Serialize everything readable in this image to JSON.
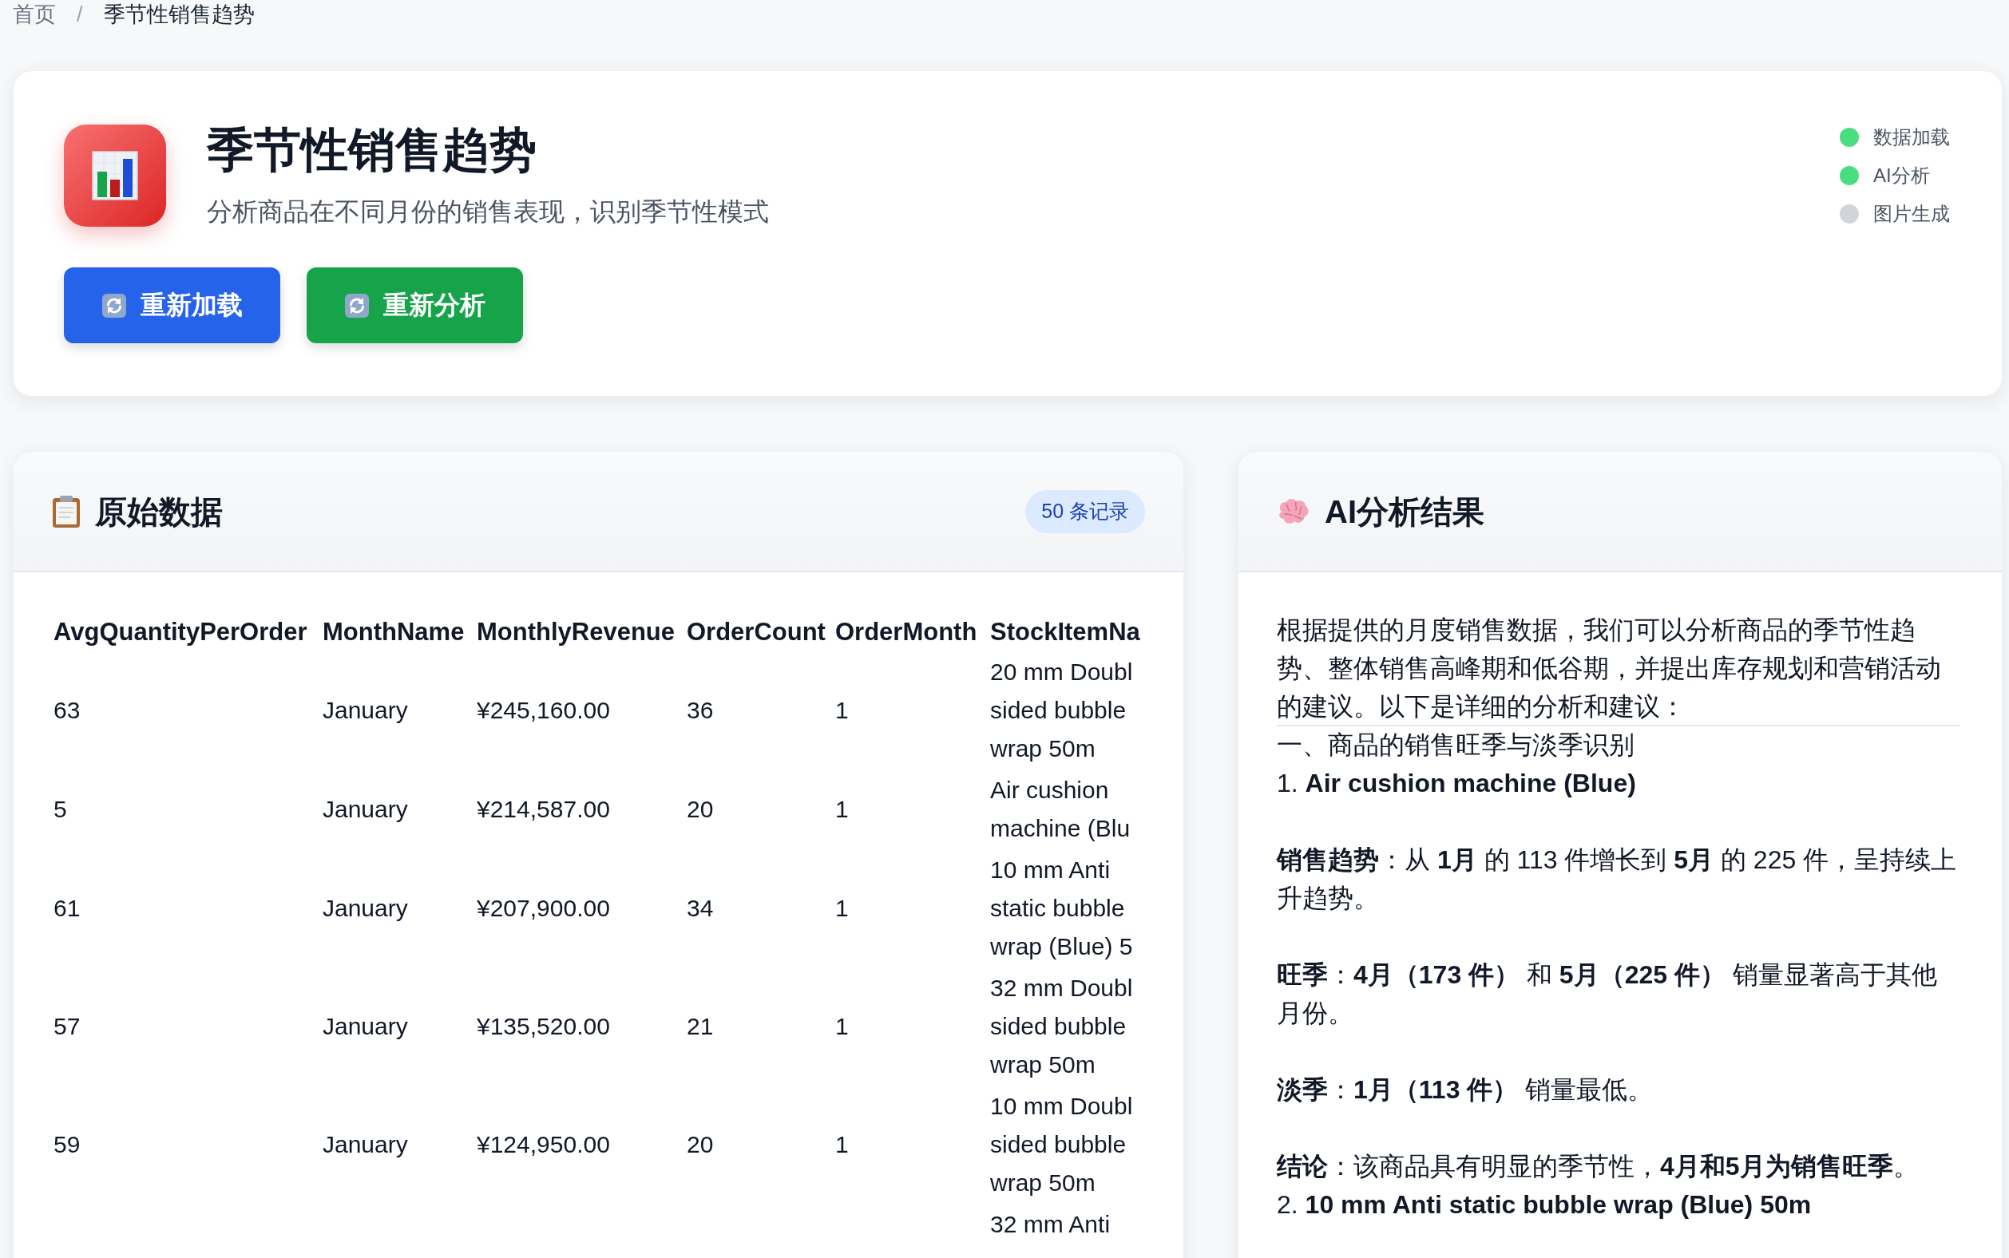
{
  "breadcrumb": {
    "separator": "/",
    "items": [
      {
        "label": "首页",
        "current": false
      },
      {
        "label": "季节性销售趋势",
        "current": true
      }
    ]
  },
  "header": {
    "title": "季节性销售趋势",
    "subtitle": "分析商品在不同月份的销售表现，识别季节性模式",
    "buttons": [
      {
        "label": "重新加载",
        "kind": "primary"
      },
      {
        "label": "重新分析",
        "kind": "success"
      }
    ],
    "status": [
      {
        "label": "数据加载",
        "done": true
      },
      {
        "label": "AI分析",
        "done": true
      },
      {
        "label": "图片生成",
        "done": false
      }
    ]
  },
  "raw_data": {
    "title": "原始数据",
    "badge": "50 条记录",
    "table": {
      "columns": [
        "AvgQuantityPerOrder",
        "MonthName",
        "MonthlyRevenue",
        "OrderCount",
        "OrderMonth",
        "StockItemNa"
      ],
      "rows": [
        {
          "avg_quantity_per_order": "63",
          "month_name": "January",
          "monthly_revenue": "¥245,160.00",
          "order_count": "36",
          "order_month": "1",
          "column_6": "20 mm Doubl\nsided bubble\nwrap 50m"
        },
        {
          "avg_quantity_per_order": "5",
          "month_name": "January",
          "monthly_revenue": "¥214,587.00",
          "order_count": "20",
          "order_month": "1",
          "column_6": "Air cushion\nmachine (Blu"
        },
        {
          "avg_quantity_per_order": "61",
          "month_name": "January",
          "monthly_revenue": "¥207,900.00",
          "order_count": "34",
          "order_month": "1",
          "column_6": "10 mm Anti\nstatic bubble\nwrap (Blue) 5"
        },
        {
          "avg_quantity_per_order": "57",
          "month_name": "January",
          "monthly_revenue": "¥135,520.00",
          "order_count": "21",
          "order_month": "1",
          "column_6": "32 mm Doubl\nsided bubble\nwrap 50m"
        },
        {
          "avg_quantity_per_order": "59",
          "month_name": "January",
          "monthly_revenue": "¥124,950.00",
          "order_count": "20",
          "order_month": "1",
          "column_6": "10 mm Doubl\nsided bubble\nwrap 50m"
        },
        {
          "column_6": "32 mm Anti"
        }
      ]
    }
  },
  "ai_result": {
    "title": "AI分析结果",
    "blocks": [
      {
        "kind": "paragraph",
        "text": "根据提供的月度销售数据，我们可以分析商品的季节性趋势、整体销售高峰期和低谷期，并提出库存规划和营销活动的建议。以下是详细的分析和建议："
      },
      {
        "kind": "rule"
      },
      {
        "kind": "heading",
        "text": "一、商品的销售旺季与淡季识别"
      },
      {
        "kind": "item",
        "text": "1. **Air cushion machine (Blue)**"
      },
      {
        "kind": "point",
        "text": "**销售趋势**：从 **1月** 的 113 件增长到 **5月** 的 225 件，呈持续上升趋势。"
      },
      {
        "kind": "point",
        "text": "**旺季**：**4月（173 件）** 和 **5月（225 件）** 销量显著高于其他月份。"
      },
      {
        "kind": "point",
        "text": "**淡季**：**1月（113 件）** 销量最低。"
      },
      {
        "kind": "point",
        "text": "**结论**：该商品具有明显的季节性，**4月和5月为销售旺季**。"
      },
      {
        "kind": "item",
        "text": "2. **10 mm Anti static bubble wrap (Blue) 50m**"
      }
    ]
  }
}
